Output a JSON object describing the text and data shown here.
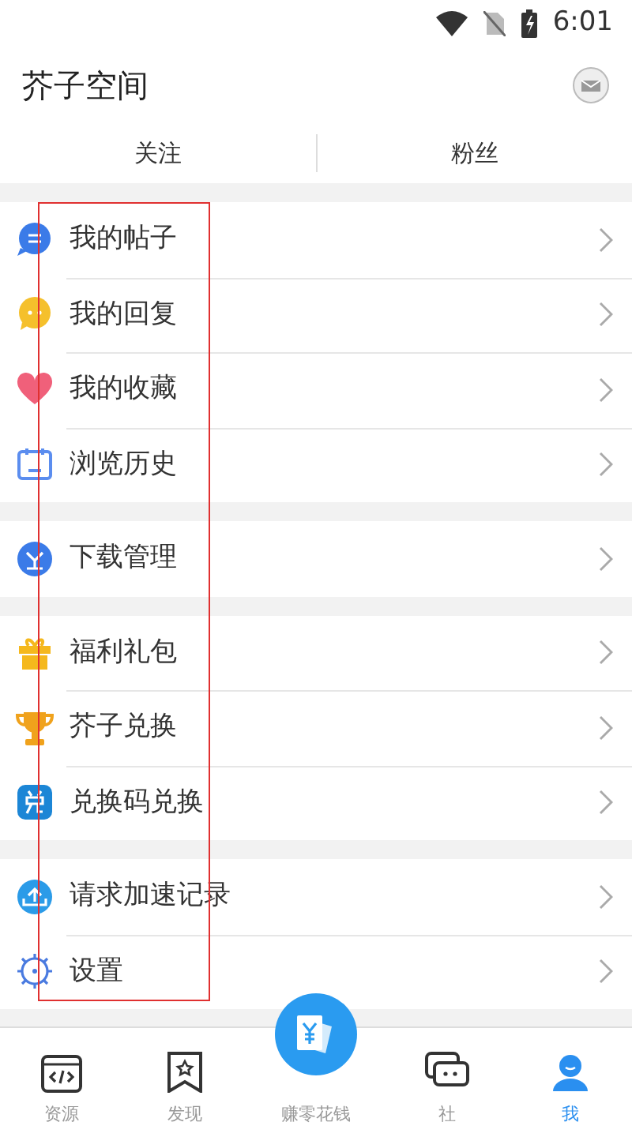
{
  "status_bar": {
    "time": "6:01"
  },
  "header": {
    "title": "芥子空间"
  },
  "follow_tabs": [
    "关注",
    "粉丝"
  ],
  "menu_groups": [
    {
      "items": [
        {
          "label": "我的帖子"
        },
        {
          "label": "我的回复"
        },
        {
          "label": "我的收藏"
        },
        {
          "label": "浏览历史"
        }
      ]
    },
    {
      "items": [
        {
          "label": "下载管理"
        }
      ]
    },
    {
      "items": [
        {
          "label": "福利礼包"
        },
        {
          "label": "芥子兑换"
        },
        {
          "label": "兑换码兑换"
        }
      ]
    },
    {
      "items": [
        {
          "label": "请求加速记录"
        },
        {
          "label": "设置"
        }
      ]
    }
  ],
  "bottom_nav": [
    {
      "label": "资源",
      "selected": false
    },
    {
      "label": "发现",
      "selected": false
    },
    {
      "label": "赚零花钱",
      "selected": false
    },
    {
      "label": "社",
      "selected": false
    },
    {
      "label": "我",
      "selected": true
    }
  ]
}
